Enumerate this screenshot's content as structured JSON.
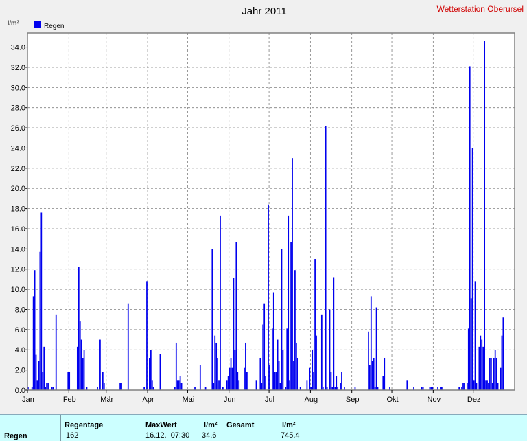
{
  "title": "Jahr 2011",
  "station": "Wetterstation Oberursel",
  "unit_label": "l/m²",
  "colors": {
    "bar": "#0000ee",
    "grid": "#808080",
    "station": "#d00000",
    "footer": "#ccffff"
  },
  "chart_data": {
    "type": "bar",
    "title": "Jahr 2011",
    "ylabel": "l/m²",
    "ylim": [
      0,
      35.4
    ],
    "yticks": [
      "0.0",
      "2.0",
      "4.0",
      "6.0",
      "8.0",
      "10.0",
      "12.0",
      "14.0",
      "16.0",
      "18.0",
      "20.0",
      "22.0",
      "24.0",
      "26.0",
      "28.0",
      "30.0",
      "32.0",
      "34.0"
    ],
    "months": [
      "Jan",
      "Feb",
      "Mär",
      "Apr",
      "Mai",
      "Jun",
      "Jul",
      "Aug",
      "Sep",
      "Okt",
      "Nov",
      "Dez"
    ],
    "grid": true,
    "legend_position": "top-left",
    "series": [
      {
        "name": "Regen",
        "color": "#0000ee",
        "points": [
          [
            1,
            0.3
          ],
          [
            4,
            0.3
          ],
          [
            5,
            9.3
          ],
          [
            6,
            11.9
          ],
          [
            7,
            3.5
          ],
          [
            8,
            1.0
          ],
          [
            9,
            2.9
          ],
          [
            10,
            13.7
          ],
          [
            11,
            17.6
          ],
          [
            12,
            1.8
          ],
          [
            13,
            4.3
          ],
          [
            14,
            0.3
          ],
          [
            15,
            0.7
          ],
          [
            16,
            0.7
          ],
          [
            19,
            0.3
          ],
          [
            20,
            0.3
          ],
          [
            22,
            7.5
          ],
          [
            31,
            1.8
          ],
          [
            32,
            1.8
          ],
          [
            38,
            4.3
          ],
          [
            39,
            12.2
          ],
          [
            40,
            6.8
          ],
          [
            41,
            5.0
          ],
          [
            42,
            3.2
          ],
          [
            43,
            4.0
          ],
          [
            45,
            0.3
          ],
          [
            53,
            0.3
          ],
          [
            55,
            5.0
          ],
          [
            57,
            1.8
          ],
          [
            58,
            0.7
          ],
          [
            70,
            0.7
          ],
          [
            71,
            0.7
          ],
          [
            76,
            8.6
          ],
          [
            88,
            0.3
          ],
          [
            90,
            10.8
          ],
          [
            92,
            3.2
          ],
          [
            93,
            4.0
          ],
          [
            94,
            1.0
          ],
          [
            95,
            0.3
          ],
          [
            100,
            3.6
          ],
          [
            111,
            0.3
          ],
          [
            112,
            4.7
          ],
          [
            113,
            1.0
          ],
          [
            114,
            1.0
          ],
          [
            115,
            1.4
          ],
          [
            116,
            0.7
          ],
          [
            126,
            0.3
          ],
          [
            130,
            2.5
          ],
          [
            134,
            0.3
          ],
          [
            139,
            14.0
          ],
          [
            140,
            0.7
          ],
          [
            141,
            5.4
          ],
          [
            142,
            4.7
          ],
          [
            143,
            3.2
          ],
          [
            144,
            1.0
          ],
          [
            145,
            17.3
          ],
          [
            147,
            0.3
          ],
          [
            150,
            1.0
          ],
          [
            151,
            1.4
          ],
          [
            152,
            2.2
          ],
          [
            153,
            3.2
          ],
          [
            154,
            2.2
          ],
          [
            155,
            11.1
          ],
          [
            156,
            4.0
          ],
          [
            157,
            14.7
          ],
          [
            158,
            1.8
          ],
          [
            159,
            1.0
          ],
          [
            163,
            2.2
          ],
          [
            164,
            4.7
          ],
          [
            165,
            1.8
          ],
          [
            172,
            1.0
          ],
          [
            175,
            3.2
          ],
          [
            176,
            0.7
          ],
          [
            177,
            6.5
          ],
          [
            178,
            8.6
          ],
          [
            179,
            1.4
          ],
          [
            181,
            18.4
          ],
          [
            182,
            2.5
          ],
          [
            184,
            6.1
          ],
          [
            185,
            9.7
          ],
          [
            186,
            1.8
          ],
          [
            187,
            1.8
          ],
          [
            188,
            5.0
          ],
          [
            189,
            2.9
          ],
          [
            190,
            0.7
          ],
          [
            191,
            14.0
          ],
          [
            192,
            4.0
          ],
          [
            194,
            0.3
          ],
          [
            195,
            6.1
          ],
          [
            196,
            17.3
          ],
          [
            197,
            1.0
          ],
          [
            198,
            14.7
          ],
          [
            199,
            23.0
          ],
          [
            200,
            2.9
          ],
          [
            201,
            11.9
          ],
          [
            202,
            4.7
          ],
          [
            203,
            3.2
          ],
          [
            205,
            0.3
          ],
          [
            210,
            1.0
          ],
          [
            212,
            2.2
          ],
          [
            213,
            0.3
          ],
          [
            214,
            4.0
          ],
          [
            215,
            1.8
          ],
          [
            216,
            13.0
          ],
          [
            217,
            5.4
          ],
          [
            221,
            7.5
          ],
          [
            222,
            0.3
          ],
          [
            224,
            26.2
          ],
          [
            225,
            0.3
          ],
          [
            227,
            8.0
          ],
          [
            228,
            1.8
          ],
          [
            229,
            0.3
          ],
          [
            230,
            11.2
          ],
          [
            231,
            0.3
          ],
          [
            232,
            1.4
          ],
          [
            233,
            0.3
          ],
          [
            235,
            0.7
          ],
          [
            236,
            1.8
          ],
          [
            238,
            0.3
          ],
          [
            246,
            0.3
          ],
          [
            256,
            5.8
          ],
          [
            257,
            2.5
          ],
          [
            258,
            9.3
          ],
          [
            259,
            2.9
          ],
          [
            260,
            3.2
          ],
          [
            261,
            0.3
          ],
          [
            262,
            8.2
          ],
          [
            263,
            0.3
          ],
          [
            267,
            1.4
          ],
          [
            268,
            3.2
          ],
          [
            272,
            0.3
          ],
          [
            285,
            1.0
          ],
          [
            290,
            0.3
          ],
          [
            296,
            0.3
          ],
          [
            297,
            0.3
          ],
          [
            302,
            0.3
          ],
          [
            303,
            0.3
          ],
          [
            304,
            0.3
          ],
          [
            308,
            0.3
          ],
          [
            310,
            0.3
          ],
          [
            311,
            0.3
          ],
          [
            324,
            0.3
          ],
          [
            326,
            0.3
          ],
          [
            327,
            0.7
          ],
          [
            328,
            0.7
          ],
          [
            330,
            0.7
          ],
          [
            331,
            6.1
          ],
          [
            332,
            32.1
          ],
          [
            333,
            9.1
          ],
          [
            334,
            24.0
          ],
          [
            335,
            1.0
          ],
          [
            336,
            10.8
          ],
          [
            337,
            0.7
          ],
          [
            339,
            4.3
          ],
          [
            340,
            5.4
          ],
          [
            341,
            5.0
          ],
          [
            342,
            4.3
          ],
          [
            343,
            34.6
          ],
          [
            344,
            1.0
          ],
          [
            345,
            1.0
          ],
          [
            346,
            0.7
          ],
          [
            347,
            3.2
          ],
          [
            348,
            3.2
          ],
          [
            349,
            0.7
          ],
          [
            350,
            3.2
          ],
          [
            351,
            4.0
          ],
          [
            352,
            3.2
          ],
          [
            353,
            0.7
          ],
          [
            355,
            2.2
          ],
          [
            356,
            5.4
          ],
          [
            357,
            7.2
          ]
        ]
      }
    ]
  },
  "footer": {
    "row_label": "Regen",
    "regentage_label": "Regentage",
    "regentage_value": "162",
    "maxwert_label": "MaxWert",
    "maxwert_unit": "l/m²",
    "maxwert_datetime": "16.12.  07:30",
    "maxwert_value": "34.6",
    "gesamt_label": "Gesamt",
    "gesamt_unit": "l/m²",
    "gesamt_value": "745.4"
  }
}
